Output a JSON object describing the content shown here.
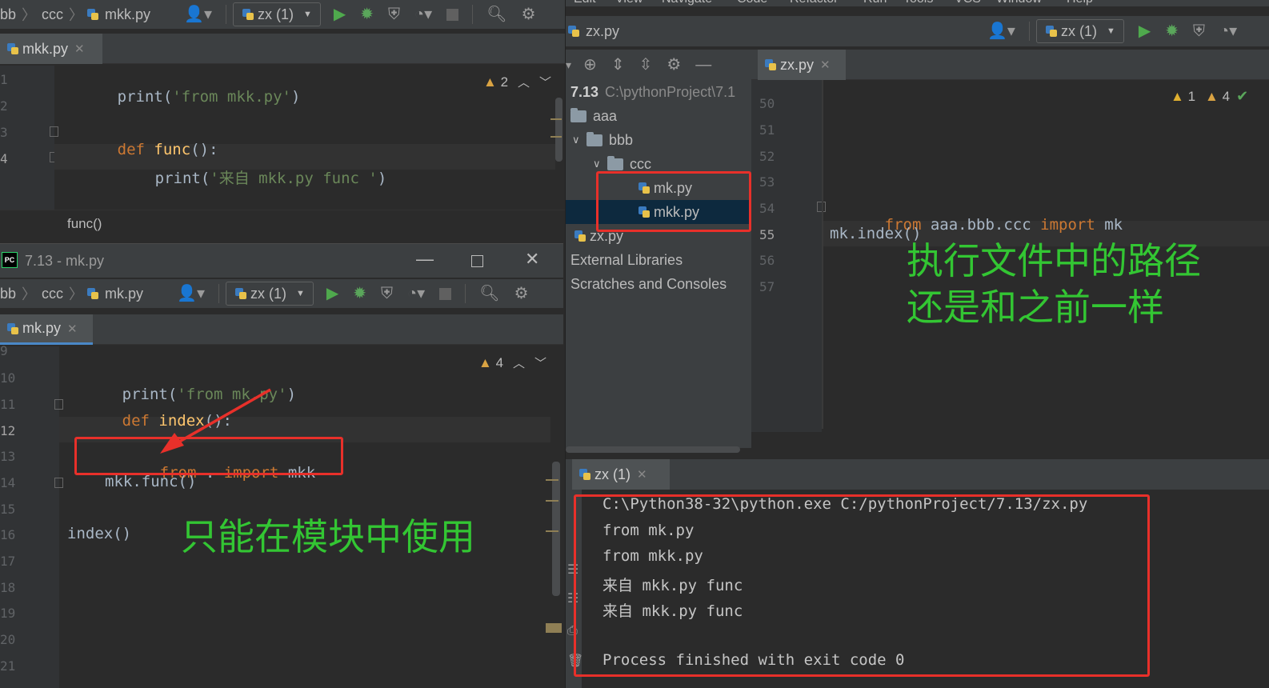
{
  "top_left": {
    "breadcrumb": [
      "bb",
      "ccc",
      "mkk.py"
    ],
    "run_config": "zx (1)",
    "tab": "mkk.py",
    "warnings": "2",
    "lines": [
      "1",
      "2",
      "3",
      "4"
    ],
    "code": {
      "l1_fn": "print(",
      "l1_str": "'from mkk.py'",
      "l1_end": ")",
      "l3_kw": "def",
      "l3_name": "func",
      "l3_end": "():",
      "l4_fn": "print(",
      "l4_str": "'来自 mkk.py func '",
      "l4_end": ")"
    },
    "structure_path": "func()"
  },
  "bottom_left": {
    "title": "7.13 - mk.py",
    "breadcrumb": [
      "bb",
      "ccc",
      "mk.py"
    ],
    "run_config": "zx (1)",
    "tab": "mk.py",
    "warnings": "4",
    "lines": [
      "9",
      "10",
      "11",
      "12",
      "13",
      "14",
      "15",
      "16",
      "17",
      "18",
      "19",
      "20",
      "21"
    ],
    "code": {
      "l10_fn": "print(",
      "l10_str": "'from mk.py'",
      "l10_end": ")",
      "l11_kw": "def",
      "l11_name": "index",
      "l11_end": "():",
      "l13_kw1": "from",
      "l13_mid": " . ",
      "l13_kw2": "import",
      "l13_mod": " mkk",
      "l14": "mkk.func()",
      "l16": "index()"
    },
    "annotation": "只能在模块中使用"
  },
  "right": {
    "menu": [
      "Edit",
      "View",
      "Navigate",
      "Code",
      "Refactor",
      "Run",
      "Tools",
      "VCS",
      "Window",
      "Help"
    ],
    "breadcrumb_file": "zx.py",
    "run_config": "zx (1)",
    "tab": "zx.py",
    "project": {
      "root_name": "7.13",
      "root_path": "C:\\pythonProject\\7.1",
      "items": [
        {
          "label": "aaa",
          "type": "folder"
        },
        {
          "label": "bbb",
          "type": "folder"
        },
        {
          "label": "ccc",
          "type": "folder"
        },
        {
          "label": "mk.py",
          "type": "file"
        },
        {
          "label": "mkk.py",
          "type": "file"
        },
        {
          "label": "zx.py",
          "type": "file"
        },
        {
          "label": "External Libraries",
          "type": "lib"
        },
        {
          "label": "Scratches and Consoles",
          "type": "scratch"
        }
      ]
    },
    "warnings": {
      "first": "1",
      "second": "4"
    },
    "lines": [
      "50",
      "51",
      "52",
      "53",
      "54",
      "55",
      "56",
      "57"
    ],
    "code": {
      "l54_kw1": "from",
      "l54_mod": " aaa.bbb.ccc ",
      "l54_kw2": "import",
      "l54_name": " mk",
      "l55": "mk.index()"
    },
    "annotation_line1": "执行文件中的路径",
    "annotation_line2": "还是和之前一样",
    "run_tab": "zx (1)",
    "console": [
      "C:\\Python38-32\\python.exe C:/pythonProject/7.13/zx.py",
      "from mk.py",
      "from mkk.py",
      "来自 mkk.py func",
      "来自 mkk.py func",
      "",
      "Process finished with exit code 0"
    ]
  },
  "colors": {
    "annotation": "#33c633",
    "redbox": "#e8302a",
    "keyword": "#cc7832",
    "string": "#6a8759"
  }
}
